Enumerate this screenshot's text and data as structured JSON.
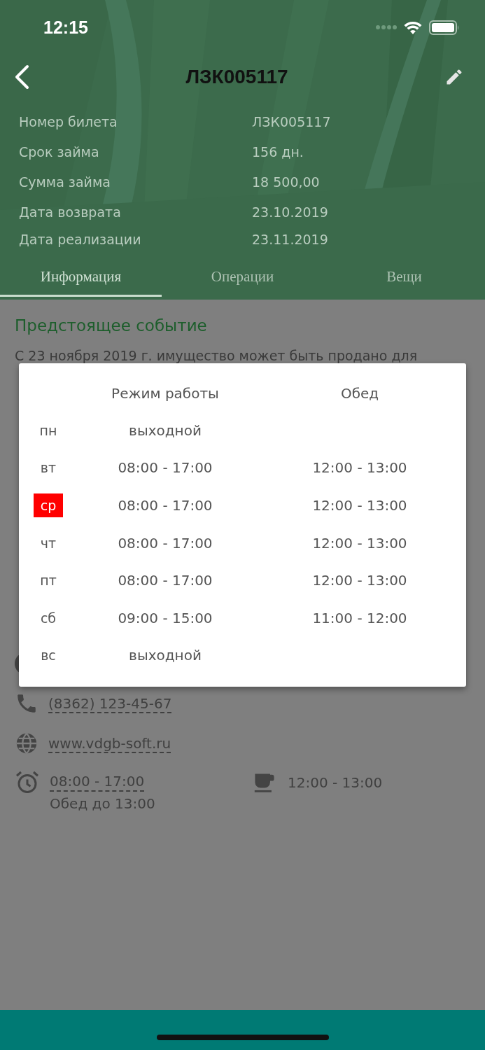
{
  "status_bar": {
    "time": "12:15"
  },
  "nav": {
    "title": "ЛЗК005117"
  },
  "info": [
    {
      "label": "Номер билета",
      "value": "ЛЗК005117"
    },
    {
      "label": "Срок займа",
      "value": "156 дн."
    },
    {
      "label": "Сумма займа",
      "value": "18 500,00"
    },
    {
      "label": "Дата возврата",
      "value": "23.10.2019"
    },
    {
      "label": "Дата реализации",
      "value": "23.11.2019"
    }
  ],
  "tabs": [
    {
      "label": "Информация",
      "selected": true
    },
    {
      "label": "Операции",
      "selected": false
    },
    {
      "label": "Вещи",
      "selected": false
    }
  ],
  "sections": [
    {
      "heading": "Предстоящее событие",
      "lines": [
        "С 23 ноября 2019 г. имущество может быть продано для"
      ]
    }
  ],
  "contacts": [
    {
      "kind": "phone",
      "text": "(8362) 123-45-67"
    },
    {
      "kind": "web",
      "text": "www.vdgb-soft.ru"
    }
  ],
  "hours": {
    "time": "08:00 - 17:00",
    "note": "Обед до 13:00",
    "lunch": "12:00 - 13:00"
  },
  "schedule": {
    "columns": [
      "Режим работы",
      "Обед"
    ],
    "rows": [
      {
        "day": "пн",
        "hours": "выходной",
        "selected": false
      },
      {
        "day": "вт",
        "hours": "08:00 - 17:00",
        "lunch": "12:00 - 13:00",
        "selected": false
      },
      {
        "day": "ср",
        "hours": "08:00 - 17:00",
        "lunch": "12:00 - 13:00",
        "selected": true
      },
      {
        "day": "чт",
        "hours": "08:00 - 17:00",
        "lunch": "12:00 - 13:00",
        "selected": false
      },
      {
        "day": "пт",
        "hours": "08:00 - 17:00",
        "lunch": "12:00 - 13:00",
        "selected": false
      },
      {
        "day": "сб",
        "hours": "09:00 - 15:00",
        "lunch": "11:00 - 12:00",
        "selected": false
      },
      {
        "day": "вс",
        "hours": "выходной",
        "selected": false
      }
    ]
  }
}
